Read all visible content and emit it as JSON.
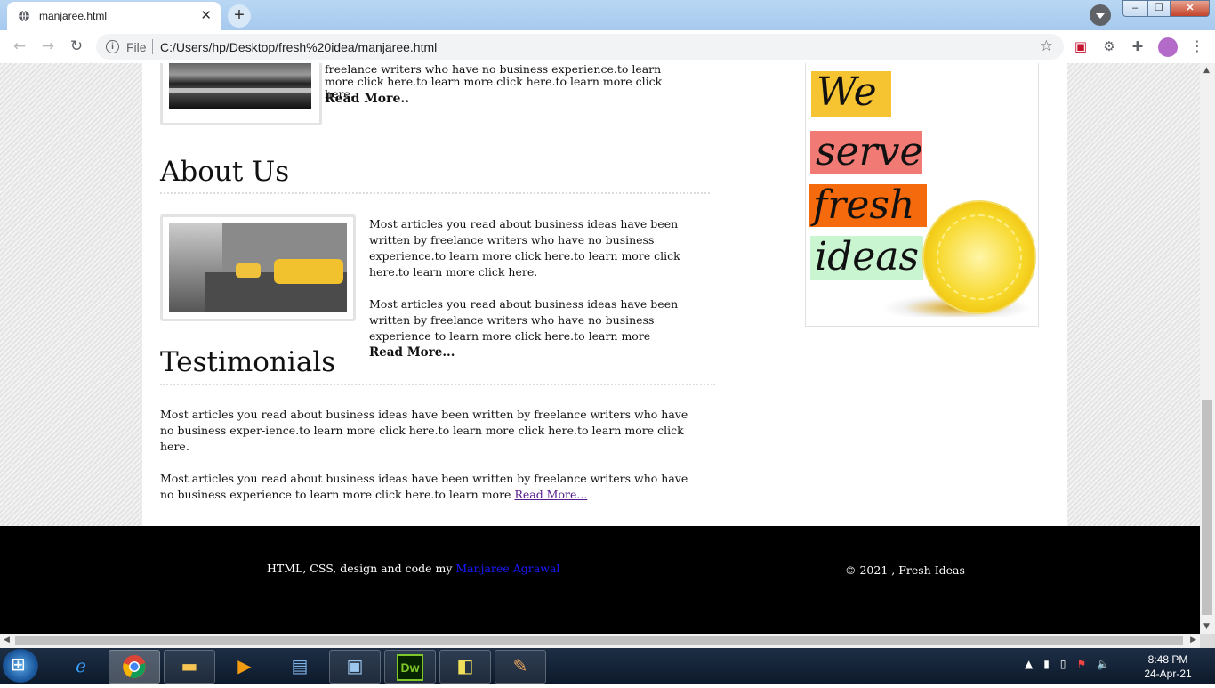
{
  "browser": {
    "tab_title": "manjaree.html",
    "new_tab_label": "+",
    "close_tab_label": "✕",
    "address_scheme": "File",
    "url": "C:/Users/hp/Desktop/fresh%20idea/manjaree.html",
    "window_buttons": {
      "minimize": "–",
      "maximize": "❐",
      "close": "✕"
    }
  },
  "page": {
    "article": {
      "text": "freelance writers who have no business experience.to learn more click here.to learn more click here.to learn more click here.",
      "read_more": "Read More.."
    },
    "about": {
      "title": "About Us",
      "para1": "Most articles you read about business ideas have been written by freelance writers who have no business experience.to learn more click here.to learn more click here.to learn more click here.",
      "para2": "Most articles you read about business ideas have been written by freelance writers who have no business experience to learn more click here.to learn more ",
      "read_more": "Read More..."
    },
    "testimonials": {
      "title": "Testimonials",
      "para1": "Most articles you read about business ideas have been written by freelance writers who have no business exper-ience.to learn more click here.to learn more click here.to learn more click here.",
      "para2": "Most articles you read about business ideas have been written by freelance writers who have no business experience to learn more click here.to learn more ",
      "read_more": "Read More..."
    },
    "sidebar_banner": {
      "words": [
        "We",
        "serve",
        "fresh",
        "ideas"
      ]
    },
    "footer": {
      "credit_prefix": "HTML, CSS, design and code my ",
      "author": "Manjaree Agrawal",
      "copyright": "© 2021 , Fresh Ideas"
    }
  },
  "taskbar": {
    "time": "8:48 PM",
    "date": "24-Apr-21",
    "apps": [
      "internet-explorer",
      "chrome",
      "file-explorer",
      "media-player",
      "remote-desktop",
      "photo-viewer",
      "dreamweaver",
      "sticky-notes",
      "paint"
    ],
    "dw_label": "Dw"
  }
}
